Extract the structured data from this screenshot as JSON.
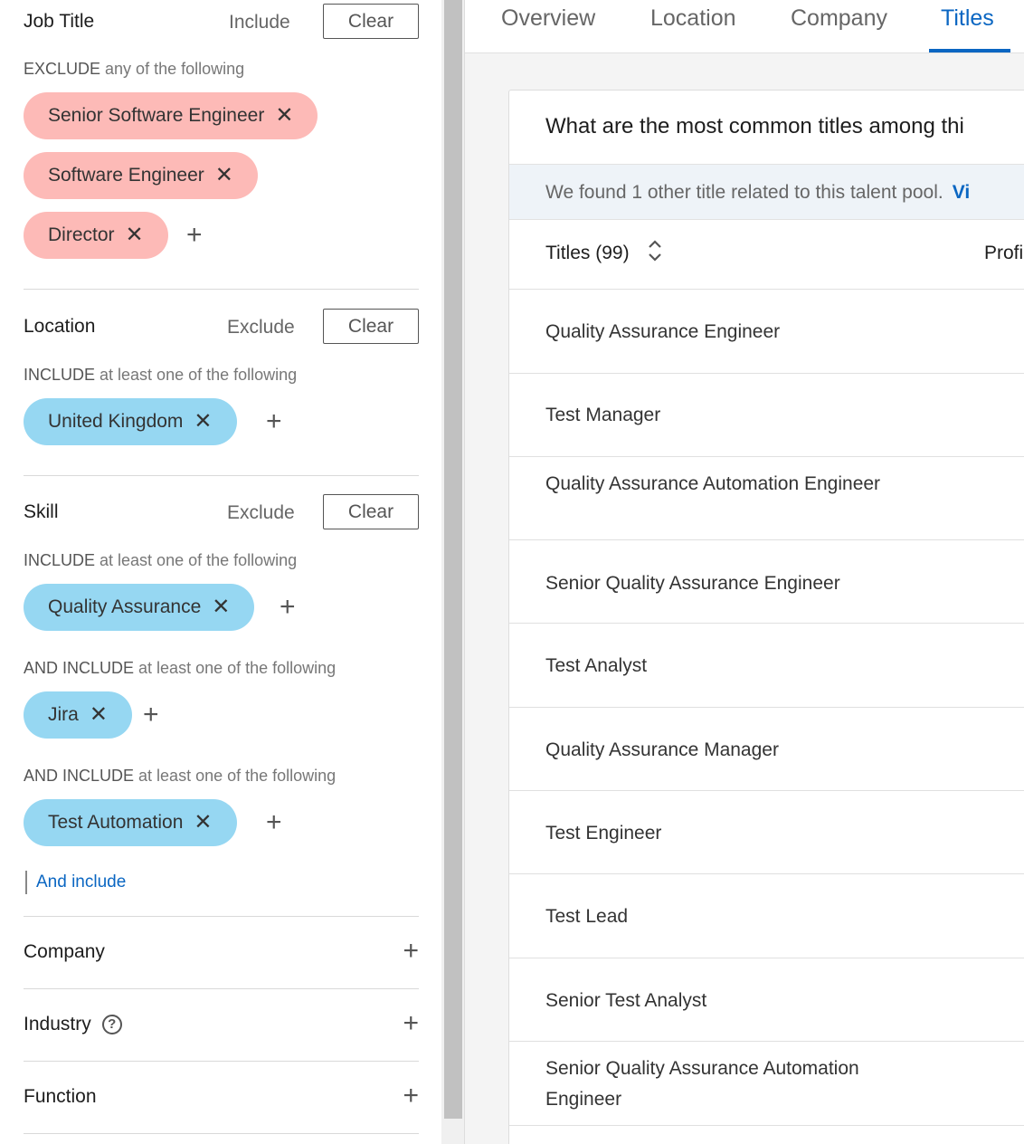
{
  "filters": {
    "job_title": {
      "title": "Job Title",
      "action": "Include",
      "clear": "Clear",
      "rule_keyword": "EXCLUDE",
      "rule_rest": " any of the following",
      "tags": [
        "Senior Software Engineer",
        "Software Engineer",
        "Director"
      ]
    },
    "location": {
      "title": "Location",
      "action": "Exclude",
      "clear": "Clear",
      "rule_keyword": "INCLUDE",
      "rule_rest": " at least one of the following",
      "tags": [
        "United Kingdom"
      ]
    },
    "skill": {
      "title": "Skill",
      "action": "Exclude",
      "clear": "Clear",
      "groups": [
        {
          "keyword": "INCLUDE",
          "rest": " at least one of the following",
          "tag": "Quality Assurance"
        },
        {
          "keyword": "AND INCLUDE",
          "rest": " at least one of the following",
          "tag": "Jira"
        },
        {
          "keyword": "AND INCLUDE",
          "rest": " at least one of the following",
          "tag": "Test Automation"
        }
      ],
      "and_include": "And include"
    },
    "collapsed": [
      "Company",
      "Industry",
      "Function"
    ],
    "remove_glyph": "✕",
    "add_glyph": "+"
  },
  "tabs": [
    "Overview",
    "Location",
    "Company",
    "Titles"
  ],
  "active_tab": "Titles",
  "card": {
    "question": "What are the most common titles among thi",
    "notice": "We found 1 other title related to this talent pool.",
    "notice_link": "Vi",
    "col_titles": "Titles (99)",
    "col_profiles": "Profi",
    "rows": [
      "Quality Assurance Engineer",
      "Test Manager",
      "Quality Assurance Automation Engineer",
      "Senior Quality Assurance Engineer",
      "Test Analyst",
      "Quality Assurance Manager",
      "Test Engineer",
      "Test Lead",
      "Senior Test Analyst",
      "Senior Quality Assurance Automation Engineer"
    ]
  }
}
